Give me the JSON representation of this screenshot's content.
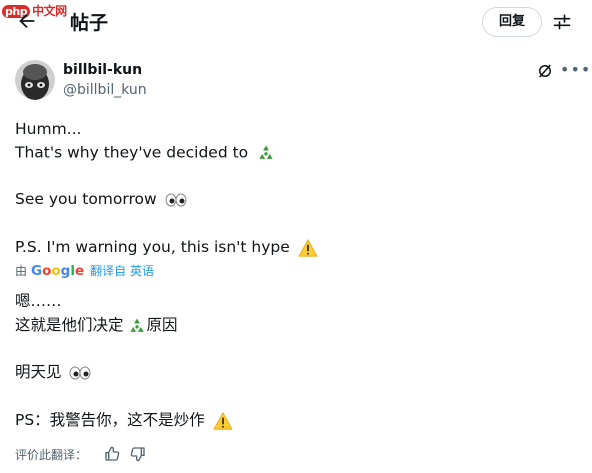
{
  "watermark": {
    "badge": "php",
    "text": "中文网"
  },
  "header": {
    "title": "帖子",
    "reply_label": "回复"
  },
  "post": {
    "author_name": "billbil-kun",
    "author_handle": "@billbil_kun",
    "lines": [
      "Humm...",
      "That's why they've decided to",
      "See you tomorrow",
      "P.S. I'm warning you, this isn't hype"
    ],
    "translation": {
      "by": "由",
      "brand_letters": [
        "G",
        "o",
        "o",
        "g",
        "l",
        "e"
      ],
      "link": "翻译自 英语"
    },
    "translated_lines": [
      "嗯……",
      "这就是他们决定",
      "原因",
      "明天见",
      "PS：我警告你，这不是炒作"
    ],
    "rate_label": "评价此翻译："
  },
  "icons": {
    "back": "arrow-left-icon",
    "settings": "sliders-icon",
    "grok": "grok-icon",
    "more": "more-icon",
    "recycle": "recycle-emoji",
    "eyes": "eyes-emoji",
    "warning": "warning-emoji",
    "thumbs_up": "thumbs-up-icon",
    "thumbs_down": "thumbs-down-icon"
  },
  "colors": {
    "text": "#0f1419",
    "secondary": "#536471",
    "link": "#1d9bf0",
    "border": "#cfd9de"
  }
}
